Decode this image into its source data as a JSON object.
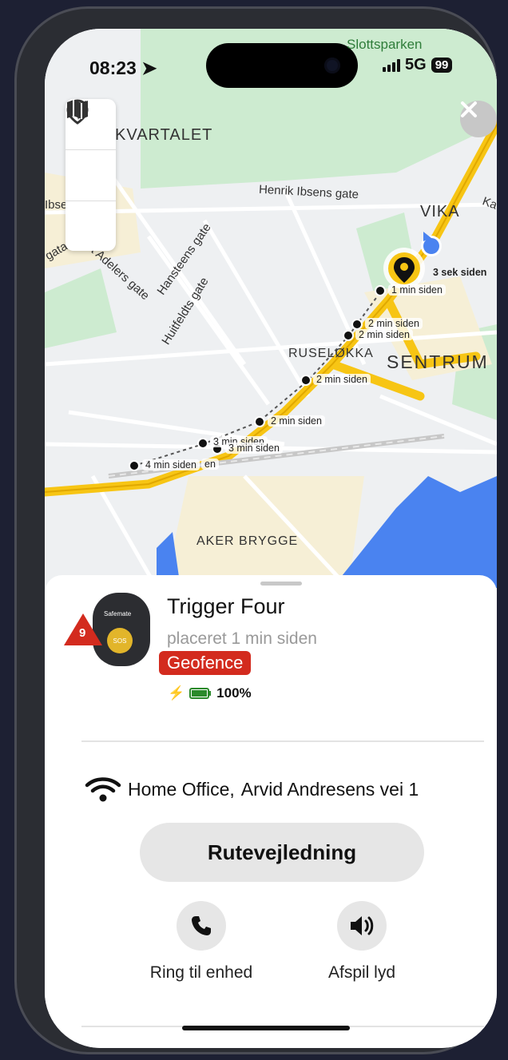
{
  "status_bar": {
    "time": "08:23",
    "network": "5G",
    "battery": "99"
  },
  "map": {
    "labels": {
      "kvartalet": "KVARTALET",
      "slottsparken": "Slottsparken",
      "vika": "VIKA",
      "sentrum": "SENTRUM",
      "ruselokka": "RUSELØKKA",
      "aker_brygge": "AKER BRYGGE",
      "henrik_ibsens": "Henrik Ibsens gate",
      "hansteens": "Hansteens gate",
      "huitfeldts": "Huitfeldts gate",
      "adelers": "Ort Adelers gate",
      "ibsens_left": "Ibse",
      "gata_left": "gata",
      "ka_right": "Ka"
    },
    "time_tags": [
      "3 sek siden",
      "1 min siden",
      "2 min siden",
      "2 min siden",
      "2 min siden",
      "2 min siden",
      "3 min siden",
      "3 min siden",
      "4 min siden",
      "en"
    ]
  },
  "device": {
    "name": "Trigger Four",
    "located": "placeret 1 min siden",
    "alert_count": "9",
    "geofence_badge": "Geofence",
    "battery_percent": "100%",
    "brand": "Safemate",
    "sos": "SOS"
  },
  "location": {
    "network_name": "Home Office,",
    "address": "Arvid Andresens vei 1"
  },
  "actions": {
    "route_button": "Rutevejledning",
    "call_label": "Ring til enhed",
    "sound_label": "Afspil lyd"
  },
  "colors": {
    "accent_yellow": "#f7c514",
    "alert_red": "#d32b1e",
    "water": "#4a83f0",
    "park": "#cdebd0"
  },
  "icons": {
    "map_tools": [
      "location-pin-icon",
      "navigation-arrow-icon",
      "map-icon"
    ],
    "close": "close-icon",
    "wifi": "wifi-icon",
    "call": "phone-icon",
    "sound": "speaker-icon"
  }
}
